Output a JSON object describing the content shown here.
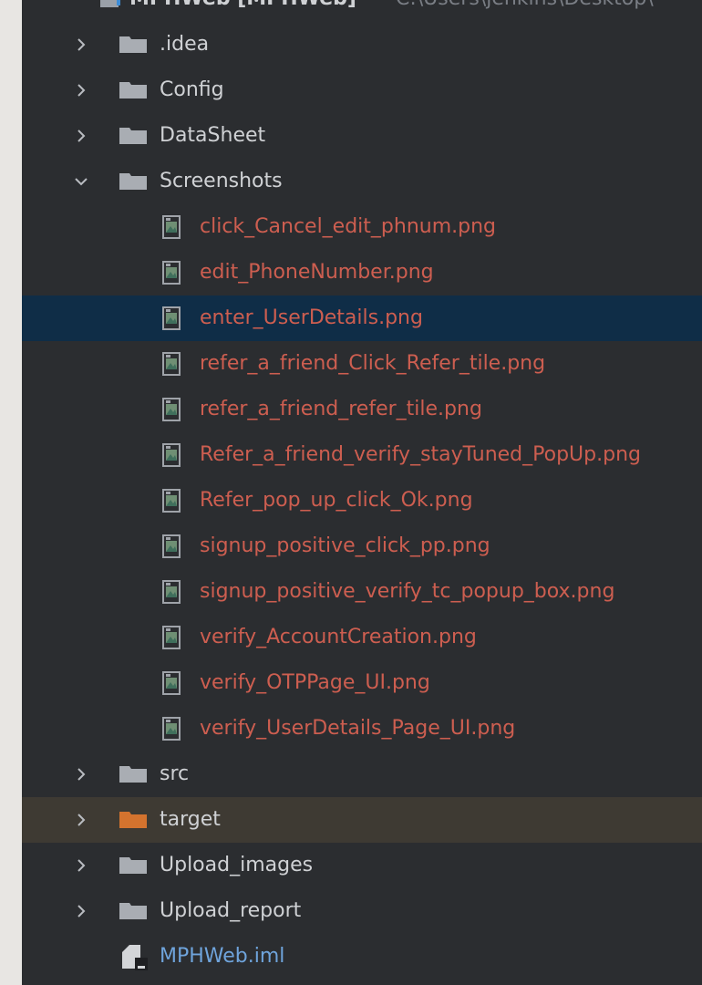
{
  "project_tree": {
    "root_fragment": {
      "label": "MPHWeb [MPHWeb]",
      "path": "C:\\Users\\jenkins\\Desktop\\"
    },
    "folders": [
      {
        "label": ".idea",
        "state": "collapsed"
      },
      {
        "label": "Config",
        "state": "collapsed"
      },
      {
        "label": "DataSheet",
        "state": "collapsed"
      },
      {
        "label": "Screenshots",
        "state": "expanded"
      }
    ],
    "screenshot_files": [
      "click_Cancel_edit_phnum.png",
      "edit_PhoneNumber.png",
      "enter_UserDetails.png",
      "refer_a_friend_Click_Refer_tile.png",
      "refer_a_friend_refer_tile.png",
      "Refer_a_friend_verify_stayTuned_PopUp.png",
      "Refer_pop_up_click_Ok.png",
      "signup_positive_click_pp.png",
      "signup_positive_verify_tc_popup_box.png",
      "verify_AccountCreation.png",
      "verify_OTPPage_UI.png",
      "verify_UserDetails_Page_UI.png"
    ],
    "selected_file": "enter_UserDetails.png",
    "folders_after": [
      {
        "label": "src",
        "state": "collapsed"
      },
      {
        "label": "target",
        "state": "collapsed",
        "excluded": true
      },
      {
        "label": "Upload_images",
        "state": "collapsed"
      },
      {
        "label": "Upload_report",
        "state": "collapsed"
      }
    ],
    "module_file": "MPHWeb.iml"
  },
  "colors": {
    "panel_bg": "#2b2d30",
    "selection_bg": "#0f2d47",
    "excluded_bg": "#3e3a33",
    "unversioned_text": "#cd5e50",
    "module_file_text": "#6fa4dc",
    "folder_gray": "#a9adb3",
    "folder_excluded": "#d4732e"
  },
  "icons": {
    "collapsed": "chevron-right-icon",
    "expanded": "chevron-down-icon",
    "folder": "folder-icon",
    "image_file": "image-file-icon",
    "module_file": "module-file-icon"
  }
}
